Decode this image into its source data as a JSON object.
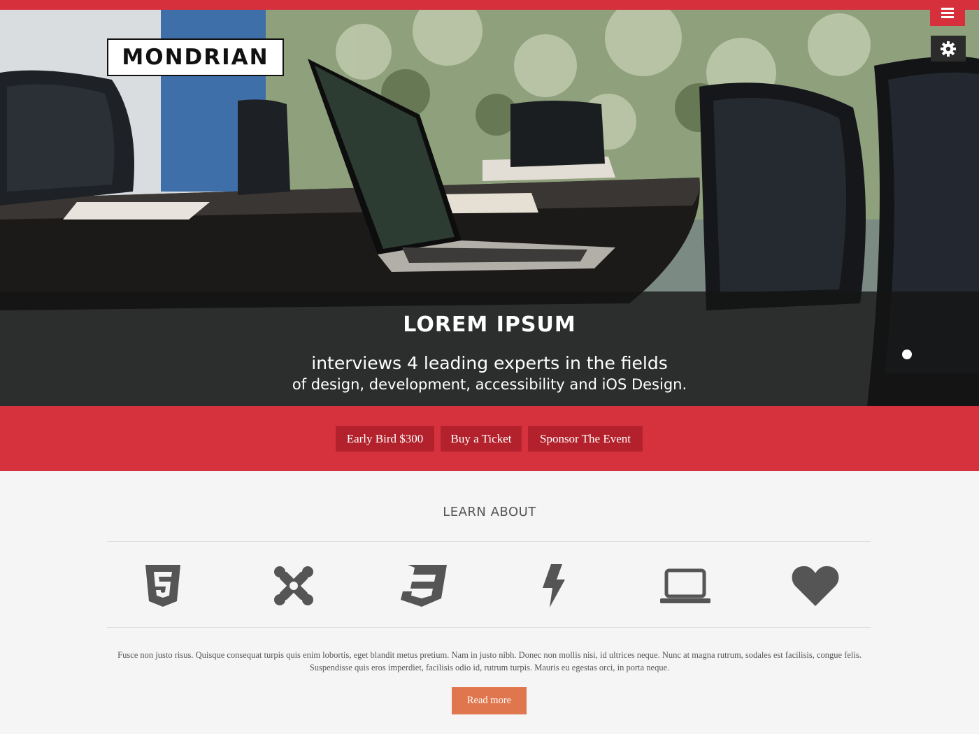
{
  "header": {
    "logo_text": "MONDRIAN",
    "menu_icon": "hamburger-icon",
    "settings_icon": "gear-icon"
  },
  "hero": {
    "title": "LOREM IPSUM",
    "line1": "interviews 4 leading experts in the fields",
    "line2": "of design, development, accessibility and iOS Design."
  },
  "cta": {
    "buttons": [
      {
        "label": "Early Bird $300"
      },
      {
        "label": "Buy a Ticket"
      },
      {
        "label": "Sponsor The Event"
      }
    ]
  },
  "learn": {
    "title": "LEARN ABOUT",
    "icons": [
      "html5-icon",
      "joomla-icon",
      "css3-icon",
      "bolt-icon",
      "laptop-icon",
      "heart-icon"
    ],
    "body": "Fusce non justo risus. Quisque consequat turpis quis enim lobortis, eget blandit metus pretium. Nam in justo nibh. Donec non mollis nisi, id ultrices neque. Nunc at magna rutrum, sodales est facilisis, congue felis. Suspendisse quis eros imperdiet, facilisis odio id, rutrum turpis. Mauris eu egestas orci, in porta neque.",
    "read_more": "Read more"
  },
  "colors": {
    "brand_red": "#d6303d",
    "button_red": "#b3222c",
    "read_more_orange": "#e0764d"
  }
}
